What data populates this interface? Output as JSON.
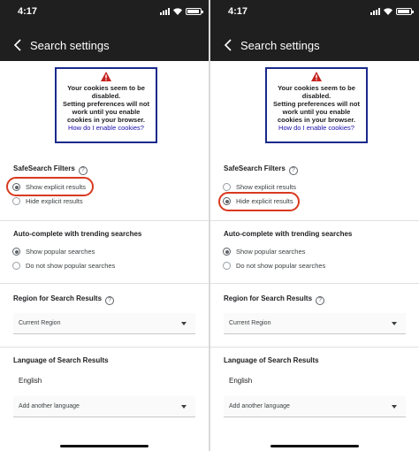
{
  "status": {
    "time": "4:17"
  },
  "header": {
    "title": "Search settings"
  },
  "cookie_notice": {
    "lines": [
      "Your cookies seem to be",
      "disabled.",
      "Setting preferences will not",
      "work until you enable",
      "cookies in your browser."
    ],
    "link": "How do I enable cookies?"
  },
  "safesearch": {
    "title": "SafeSearch Filters",
    "help": "?",
    "options": [
      "Show explicit results",
      "Hide explicit results"
    ]
  },
  "autocomplete": {
    "title": "Auto-complete with trending searches",
    "options": [
      "Show popular searches",
      "Do not show popular searches"
    ]
  },
  "region": {
    "title": "Region for Search Results",
    "help": "?",
    "value": "Current Region"
  },
  "language": {
    "title": "Language of Search Results",
    "current": "English",
    "add": "Add another language"
  },
  "panels": [
    {
      "safesearch_selected": 0
    },
    {
      "safesearch_selected": 1
    }
  ],
  "colors": {
    "appbar": "#1f1f1f",
    "highlight": "#d9391f",
    "cookie_border": "#1a2a8c",
    "link": "#1a0dab"
  }
}
